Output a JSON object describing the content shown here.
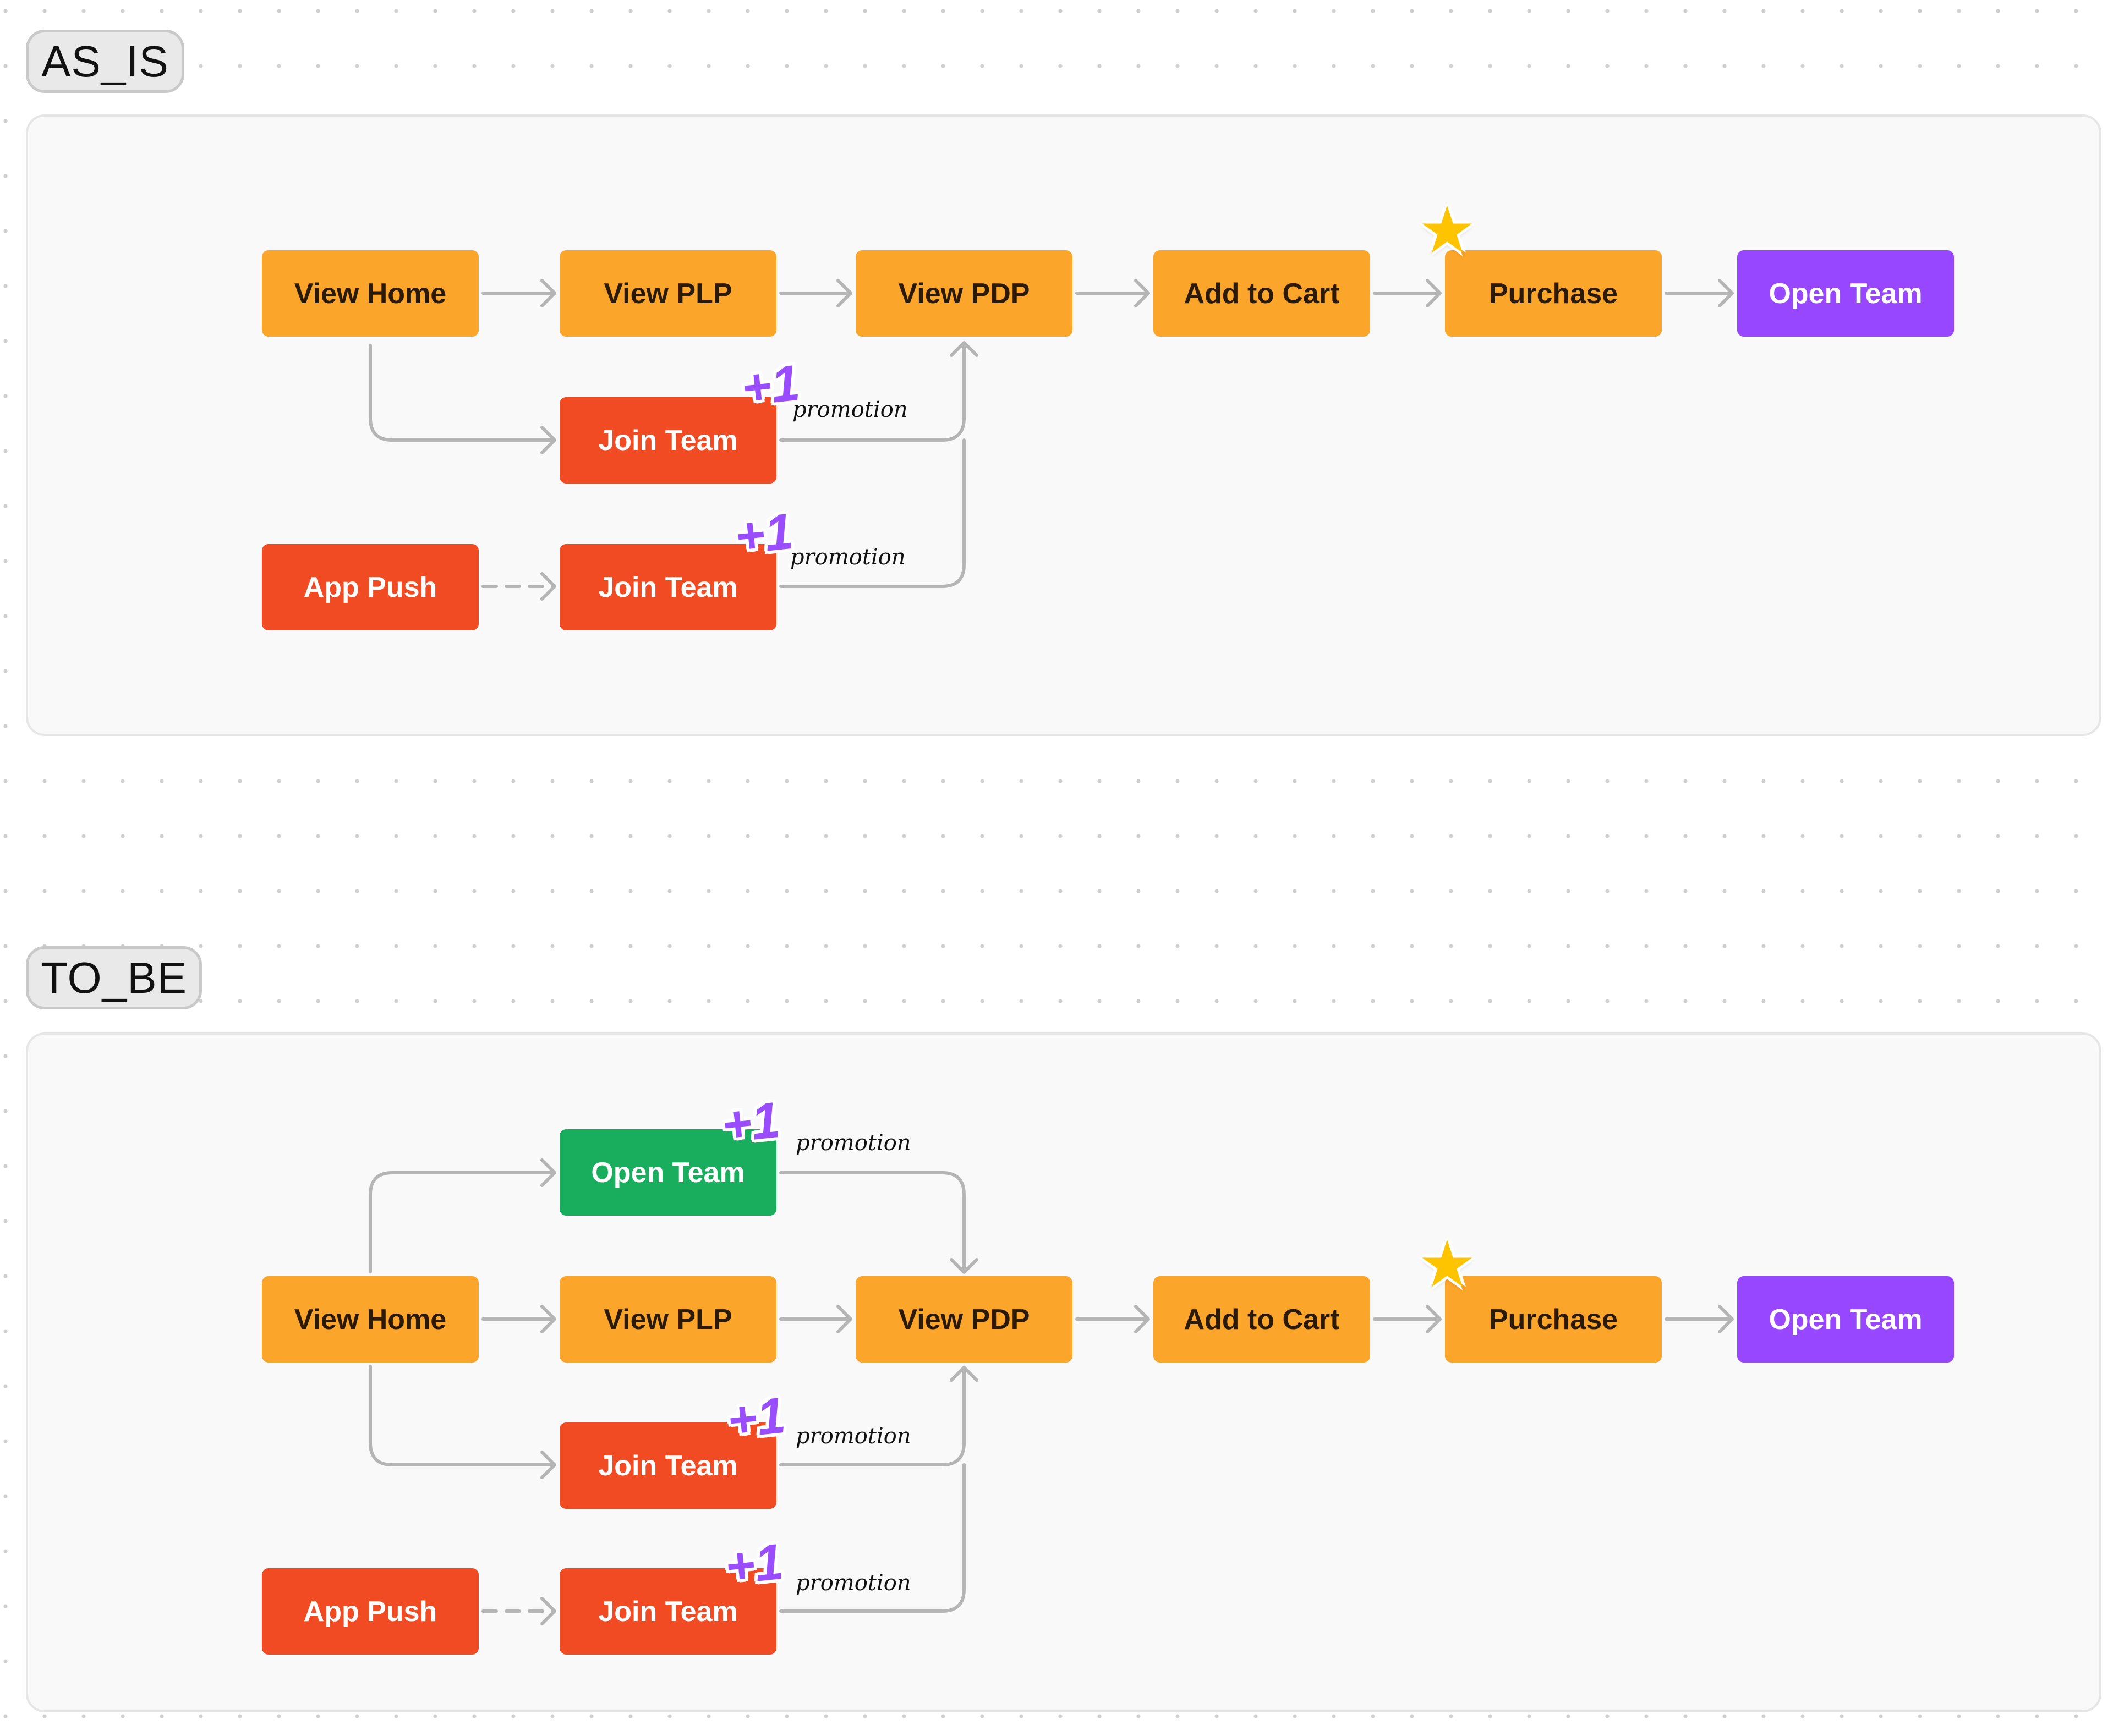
{
  "as_is": {
    "label": "AS_IS",
    "nodes": {
      "view_home": "View Home",
      "view_plp": "View PLP",
      "view_pdp": "View PDP",
      "add_to_cart": "Add to Cart",
      "purchase": "Purchase",
      "open_team": "Open Team",
      "join_team_1": "Join Team",
      "app_push": "App Push",
      "join_team_2": "Join Team"
    },
    "badges": {
      "plus": "+1",
      "promotion": "promotion",
      "star": "★"
    }
  },
  "to_be": {
    "label": "TO_BE",
    "nodes": {
      "open_team_promo": "Open Team",
      "view_home": "View Home",
      "view_plp": "View PLP",
      "view_pdp": "View PDP",
      "add_to_cart": "Add to Cart",
      "purchase": "Purchase",
      "open_team": "Open Team",
      "join_team_1": "Join Team",
      "app_push": "App Push",
      "join_team_2": "Join Team"
    },
    "badges": {
      "plus": "+1",
      "promotion": "promotion",
      "star": "★"
    }
  },
  "colors": {
    "page_view": "#fba52a",
    "entry_event": "#f04b23",
    "open_team_final": "#9747ff",
    "open_team_new": "#18ae5e",
    "connector": "#b5b5b5",
    "badge_plus": "#9a4dff",
    "star": "#ffc400"
  }
}
